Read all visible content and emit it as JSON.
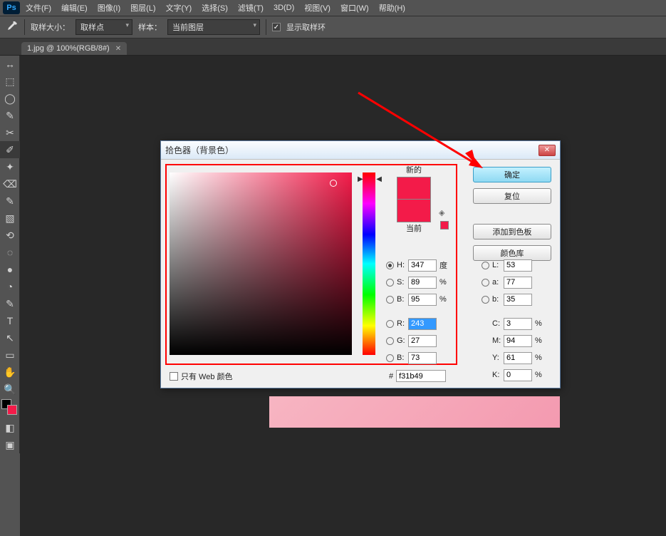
{
  "app_logo": "Ps",
  "menu": [
    "文件(F)",
    "编辑(E)",
    "图像(I)",
    "图层(L)",
    "文字(Y)",
    "选择(S)",
    "滤镜(T)",
    "3D(D)",
    "视图(V)",
    "窗口(W)",
    "帮助(H)"
  ],
  "options": {
    "sample_size_label": "取样大小：",
    "sample_size_value": "取样点",
    "sample_label": "样本：",
    "sample_value": "当前图层",
    "show_ring": "显示取样环"
  },
  "tab": {
    "title": "1.jpg @ 100%(RGB/8#)"
  },
  "tools_list": [
    "↔",
    "⬚",
    "◯",
    "✎",
    "✂",
    "✐",
    "✦",
    "⌫",
    "✎",
    "▧",
    "⟲",
    "◌",
    "●",
    "◔",
    "✎",
    "T",
    "↖",
    "▭",
    "✋",
    "🔍"
  ],
  "dialog": {
    "title": "拾色器（背景色）",
    "new_label": "新的",
    "current_label": "当前",
    "buttons": {
      "ok": "确定",
      "reset": "复位",
      "add": "添加到色板",
      "lib": "颜色库"
    },
    "hsb": {
      "H": "347",
      "S": "89",
      "B": "95",
      "H_unit": "度",
      "pct": "%"
    },
    "rgb": {
      "R": "243",
      "G": "27",
      "B": "73"
    },
    "lab": {
      "L": "53",
      "a": "77",
      "b": "35"
    },
    "cmyk": {
      "C": "3",
      "M": "94",
      "Y": "61",
      "K": "0"
    },
    "web_only": "只有 Web 颜色",
    "hex": "f31b49"
  }
}
